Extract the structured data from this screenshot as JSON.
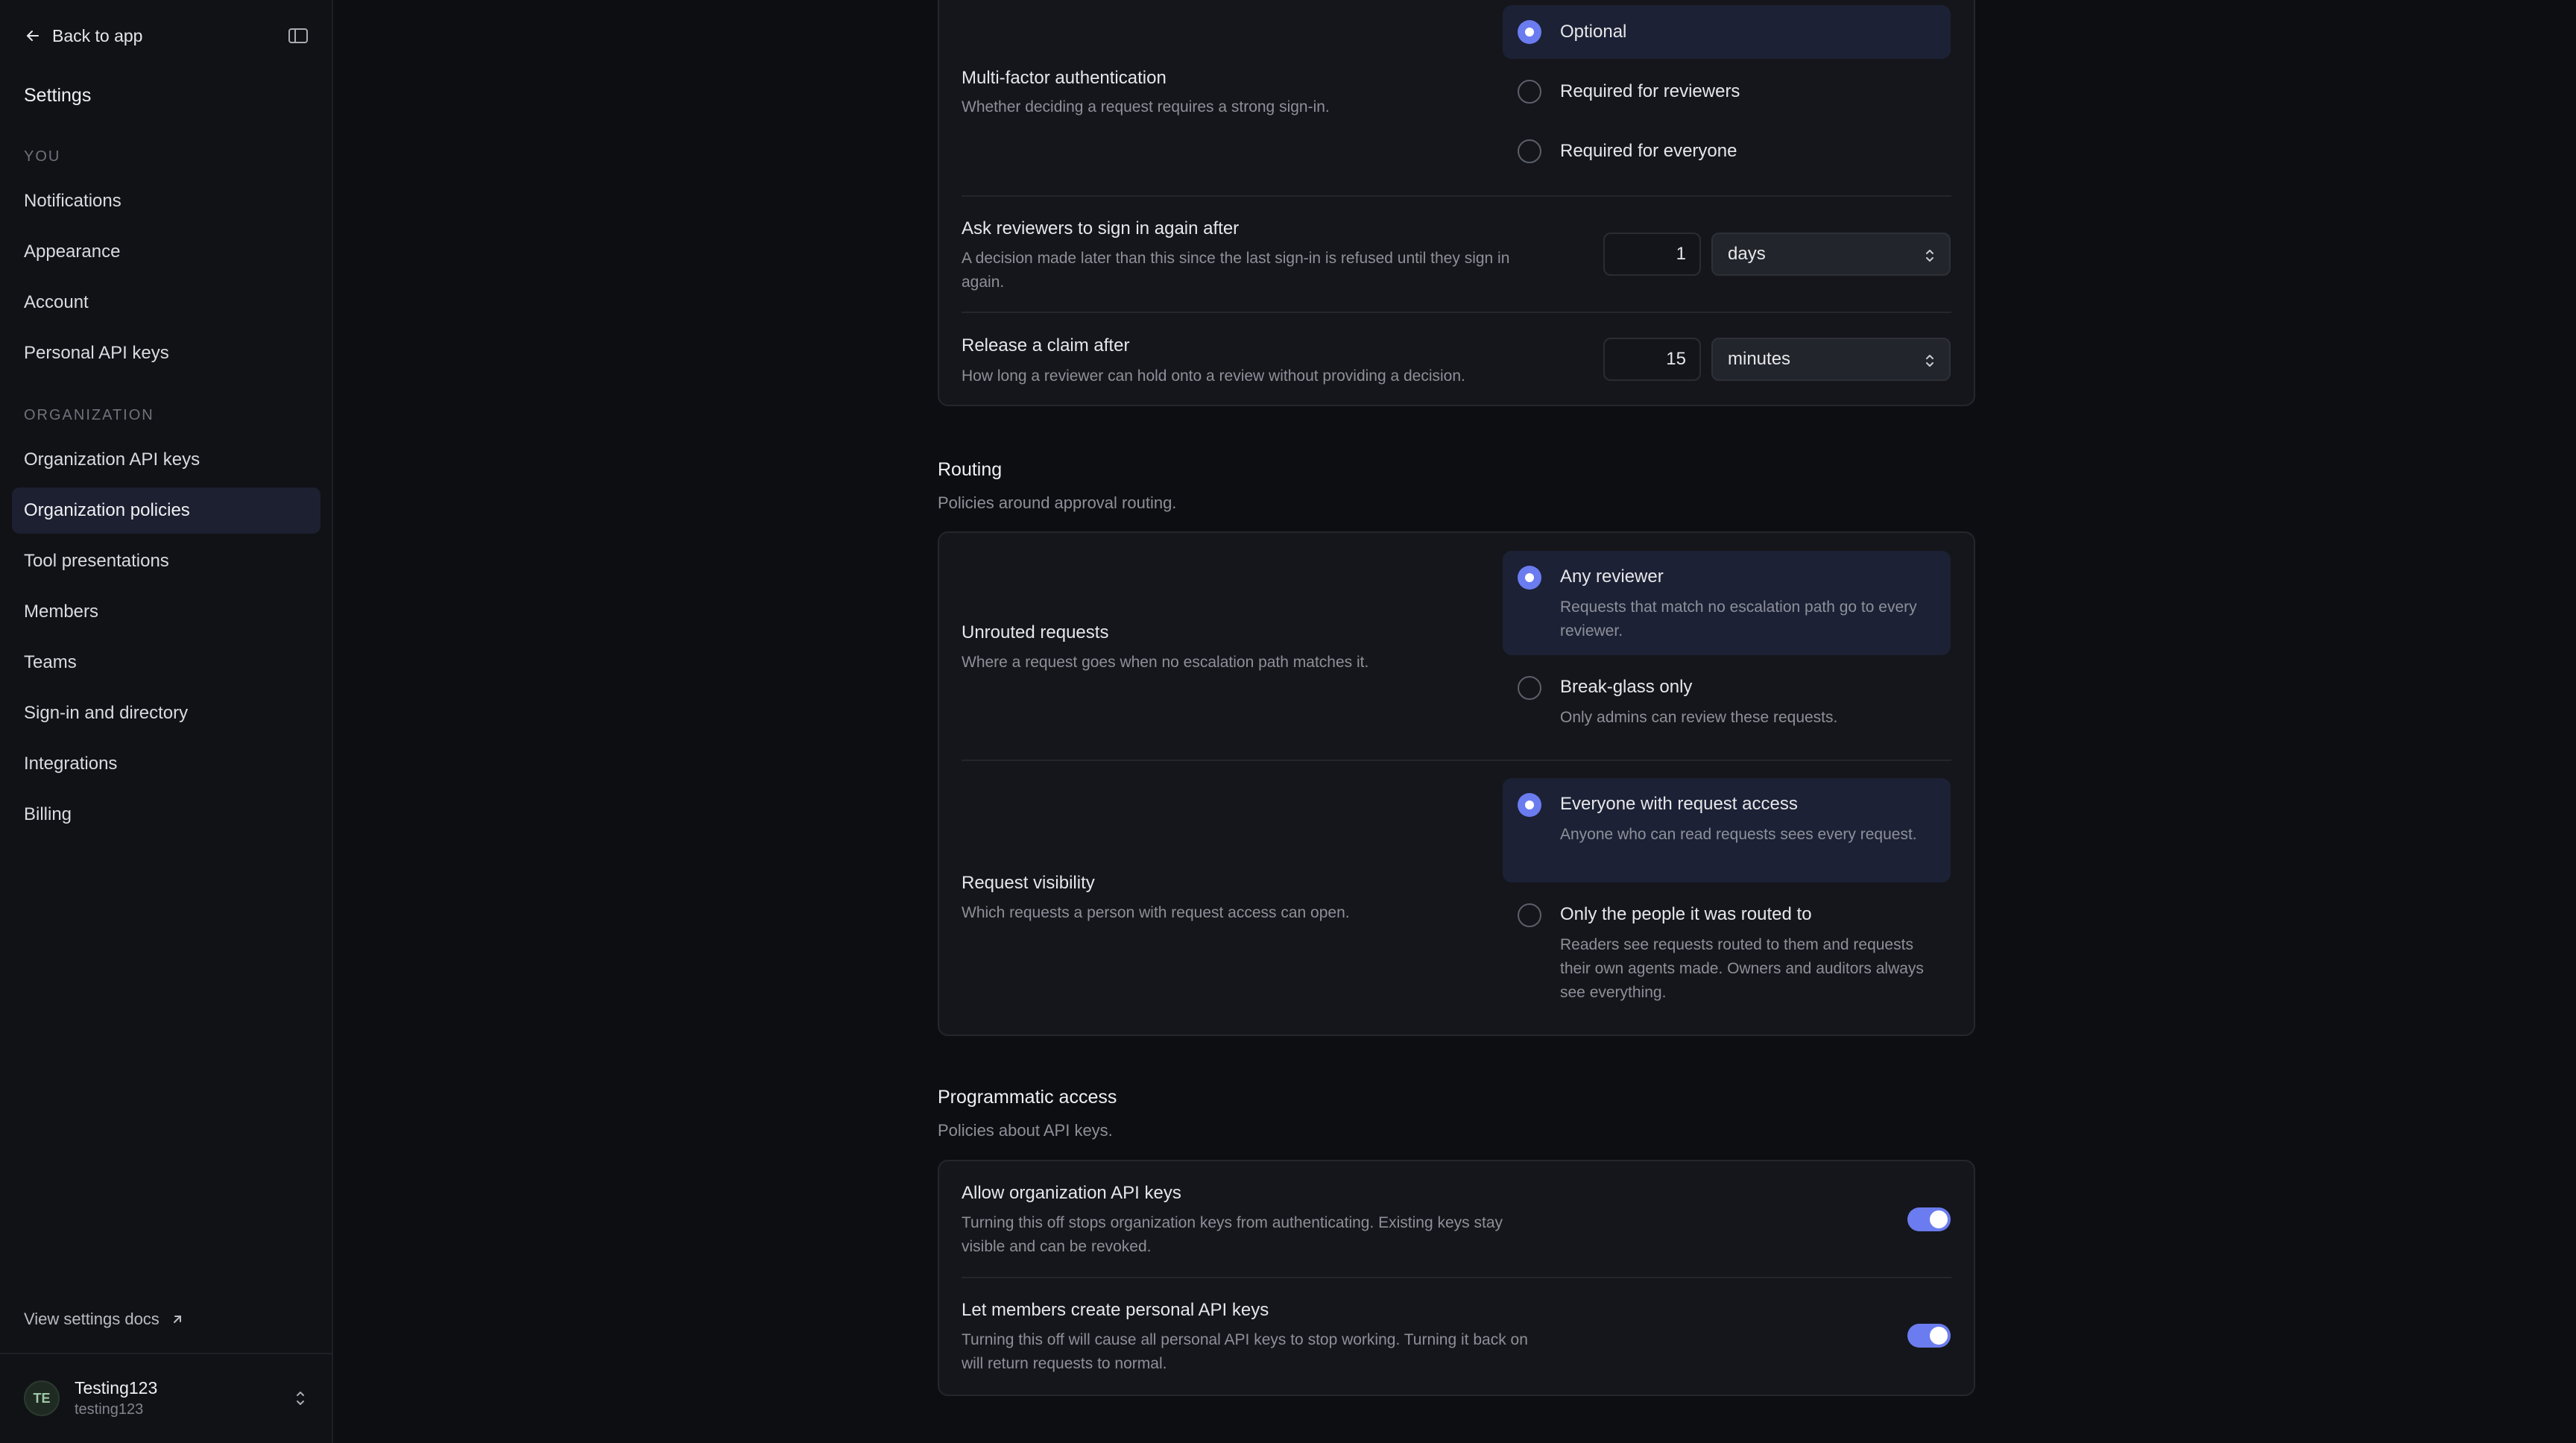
{
  "sidebar": {
    "back_label": "Back to app",
    "title": "Settings",
    "section_you": "YOU",
    "you_items": [
      "Notifications",
      "Appearance",
      "Account",
      "Personal API keys"
    ],
    "section_org": "ORGANIZATION",
    "org_items": [
      "Organization API keys",
      "Organization policies",
      "Tool presentations",
      "Members",
      "Teams",
      "Sign-in and directory",
      "Integrations",
      "Billing"
    ],
    "active_item": "Organization policies",
    "docs_label": "View settings docs",
    "user": {
      "initials": "TE",
      "name": "Testing123",
      "handle": "testing123"
    }
  },
  "auth": {
    "mfa": {
      "label": "Multi-factor authentication",
      "desc": "Whether deciding a request requires a strong sign-in.",
      "options": [
        "Optional",
        "Required for reviewers",
        "Required for everyone"
      ],
      "selected": "Optional"
    },
    "resign": {
      "label": "Ask reviewers to sign in again after",
      "desc": "A decision made later than this since the last sign-in is refused until they sign in again.",
      "value": "1",
      "unit": "days"
    },
    "claim": {
      "label": "Release a claim after",
      "desc": "How long a reviewer can hold onto a review without providing a decision.",
      "value": "15",
      "unit": "minutes"
    }
  },
  "routing": {
    "title": "Routing",
    "desc": "Policies around approval routing.",
    "unrouted": {
      "label": "Unrouted requests",
      "desc": "Where a request goes when no escalation path matches it.",
      "options": [
        {
          "label": "Any reviewer",
          "desc": "Requests that match no escalation path go to every reviewer."
        },
        {
          "label": "Break-glass only",
          "desc": "Only admins can review these requests."
        }
      ],
      "selected": "Any reviewer"
    },
    "visibility": {
      "label": "Request visibility",
      "desc": "Which requests a person with request access can open.",
      "options": [
        {
          "label": "Everyone with request access",
          "desc": "Anyone who can read requests sees every request."
        },
        {
          "label": "Only the people it was routed to",
          "desc": "Readers see requests routed to them and requests their own agents made. Owners and auditors always see everything."
        }
      ],
      "selected": "Everyone with request access"
    }
  },
  "programmatic": {
    "title": "Programmatic access",
    "desc": "Policies about API keys.",
    "org_keys": {
      "label": "Allow organization API keys",
      "desc": "Turning this off stops organization keys from authenticating. Existing keys stay visible and can be revoked.",
      "enabled": true
    },
    "personal_keys": {
      "label": "Let members create personal API keys",
      "desc": "Turning this off will cause all personal API keys to stop working. Turning it back on will return requests to normal.",
      "enabled": true
    }
  },
  "colors": {
    "accent": "#6b7cf0",
    "selected_bg": "#1c2135",
    "active_nav_bg": "#1c2030"
  }
}
